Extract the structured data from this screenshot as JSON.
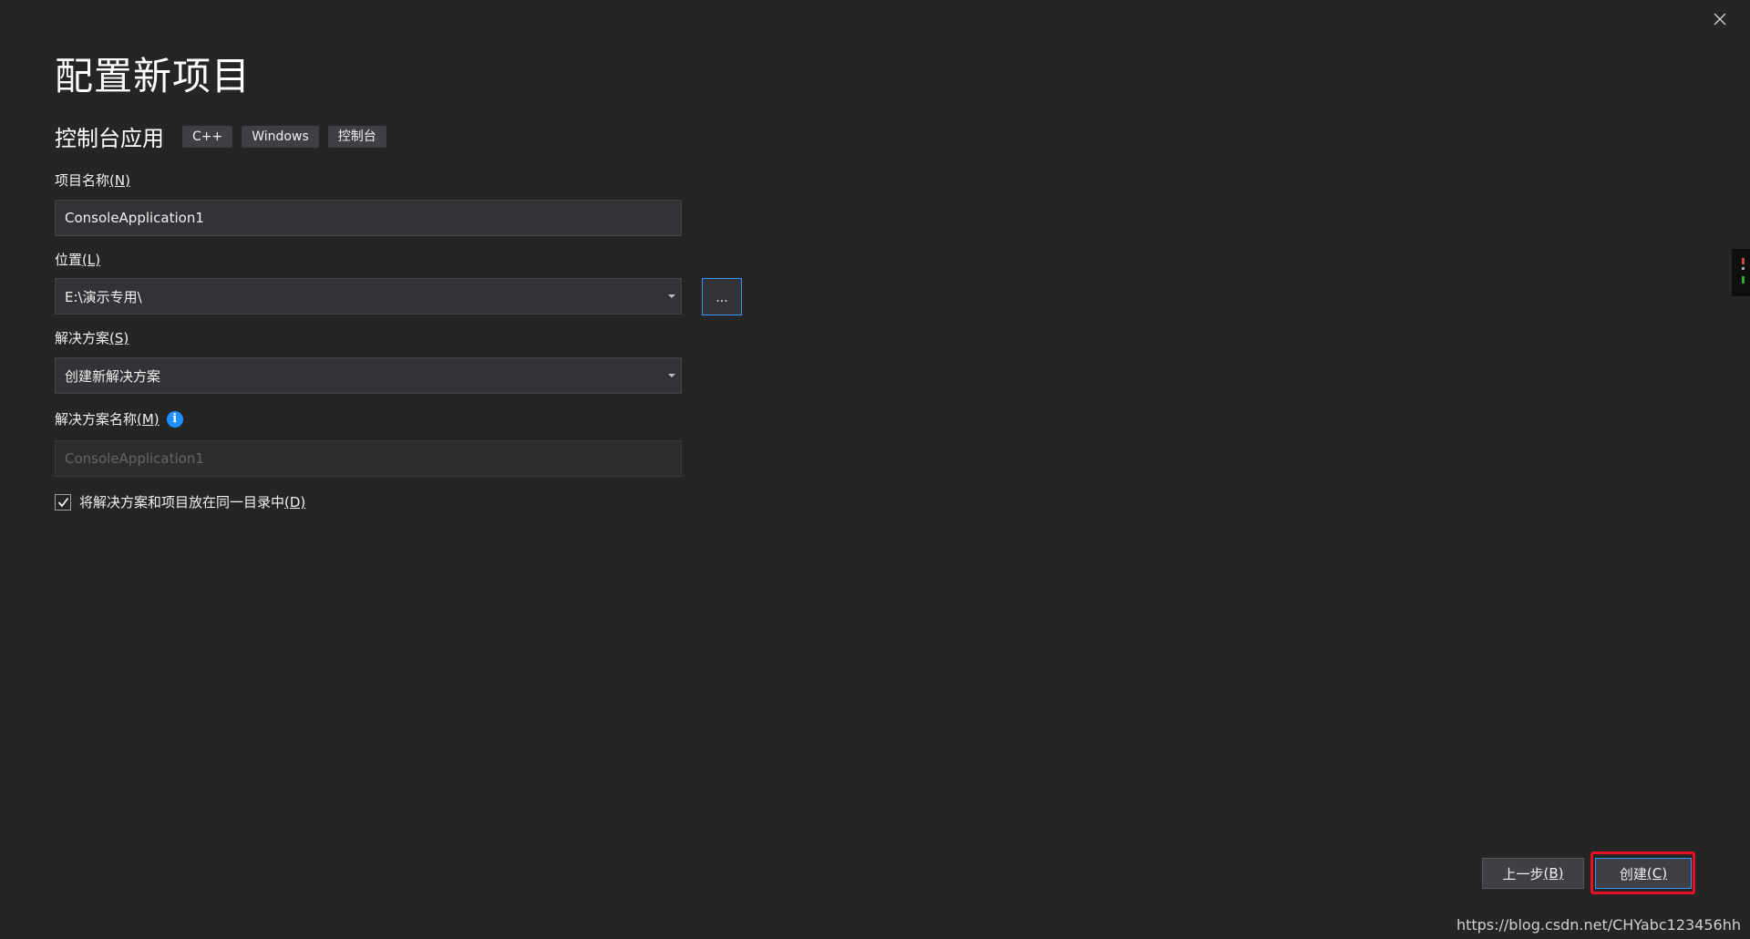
{
  "dialog": {
    "title": "配置新项目",
    "template_name": "控制台应用",
    "tags": [
      "C++",
      "Windows",
      "控制台"
    ]
  },
  "project_name": {
    "label": "项目名称",
    "mnemonic": "(N)",
    "value": "ConsoleApplication1"
  },
  "location": {
    "label": "位置",
    "mnemonic": "(L)",
    "value": "E:\\演示专用\\",
    "browse_label": "..."
  },
  "solution": {
    "label": "解决方案",
    "mnemonic": "(S)",
    "value": "创建新解决方案"
  },
  "solution_name": {
    "label": "解决方案名称",
    "mnemonic": "(M)",
    "value": "ConsoleApplication1",
    "info_icon": "info-icon"
  },
  "same_dir_checkbox": {
    "label": "将解决方案和项目放在同一目录中",
    "mnemonic": "(D)",
    "checked": true
  },
  "footer": {
    "back_label": "上一步",
    "back_mnemonic": "(B)",
    "create_label": "创建",
    "create_mnemonic": "(C)"
  },
  "colors": {
    "background": "#252526",
    "input_bg": "#333337",
    "accent": "#3399ff",
    "highlight": "#e81123"
  },
  "watermark": "https://blog.csdn.net/CHYabc123456hh"
}
